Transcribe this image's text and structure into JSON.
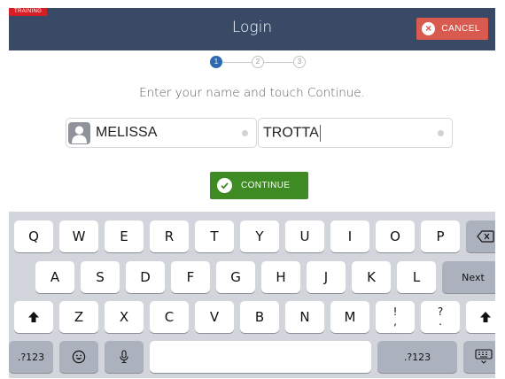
{
  "training_badge": "TRAINING",
  "header": {
    "title": "Login",
    "cancel_label": "CANCEL"
  },
  "steps": [
    "1",
    "2",
    "3"
  ],
  "instruction": "Enter your name and touch Continue.",
  "form": {
    "first_name": "MELISSA",
    "last_name": "TROTTA"
  },
  "continue_label": "CONTINUE",
  "keyboard": {
    "row1": [
      "Q",
      "W",
      "E",
      "R",
      "T",
      "Y",
      "U",
      "I",
      "O",
      "P"
    ],
    "row2": [
      "A",
      "S",
      "D",
      "F",
      "G",
      "H",
      "J",
      "K",
      "L"
    ],
    "next_label": "Next",
    "row3": [
      "Z",
      "X",
      "C",
      "V",
      "B",
      "N",
      "M"
    ],
    "punct1": [
      "!",
      ","
    ],
    "punct2": [
      "?",
      "."
    ],
    "numbers_label": ".?123"
  },
  "colors": {
    "header": "#384a65",
    "cancel": "#d95a4e",
    "continue": "#3d8b22",
    "active_step": "#2c6bb0",
    "training": "#d51f26"
  }
}
